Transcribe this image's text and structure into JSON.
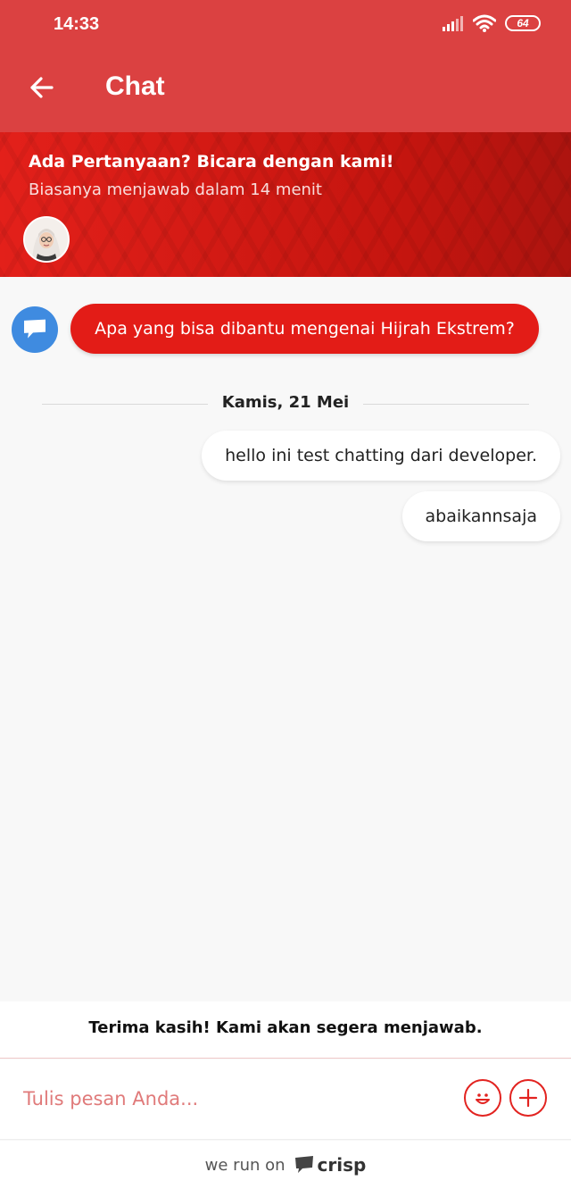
{
  "status_bar": {
    "time": "14:33",
    "battery": "64"
  },
  "app_bar": {
    "title": "Chat",
    "back_icon": "arrow-left-icon"
  },
  "banner": {
    "title": "Ada Pertanyaan? Bicara dengan kami!",
    "subtitle": "Biasanya menjawab dalam 14 menit"
  },
  "messages": {
    "bot_greeting": "Apa yang bisa dibantu mengenai Hijrah Ekstrem?",
    "date_separator": "Kamis, 21 Mei",
    "user": [
      {
        "text": "hello ini test chatting dari developer."
      },
      {
        "text": "abaikannsaja"
      }
    ]
  },
  "notice": "Terima kasih! Kami akan segera menjawab.",
  "composer": {
    "placeholder": "Tulis pesan Anda...",
    "emoji_icon": "smiley-icon",
    "attach_icon": "plus-icon"
  },
  "footer": {
    "prefix": "we run on",
    "brand": "crisp"
  },
  "colors": {
    "app_bar": "#db4141",
    "accent_red": "#e31c17",
    "bot_avatar": "#3f8be0",
    "placeholder": "#e07a7a"
  }
}
